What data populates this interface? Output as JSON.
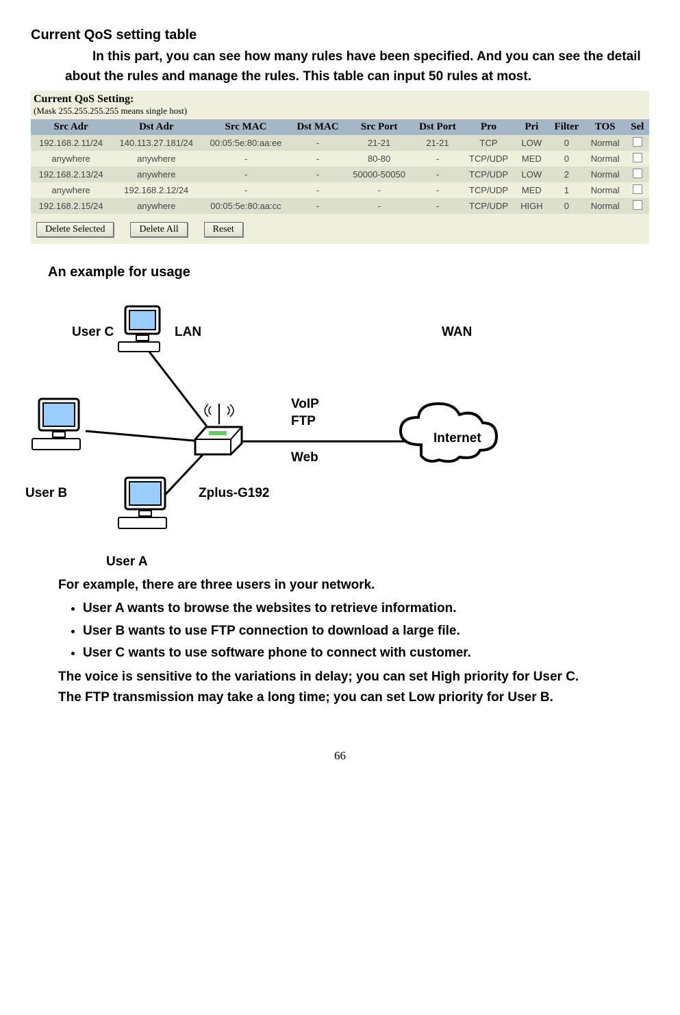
{
  "heading_qos": "Current QoS setting table",
  "intro_para": "In this part, you can see how many rules have been specified. And you can see the detail about the rules and manage the rules. This table can input 50 rules at most.",
  "shot": {
    "title": "Current QoS Setting:",
    "subtitle": "(Mask 255.255.255.255 means single host)",
    "headers": [
      "Src Adr",
      "Dst Adr",
      "Src MAC",
      "Dst MAC",
      "Src Port",
      "Dst Port",
      "Pro",
      "Pri",
      "Filter",
      "TOS",
      "Sel"
    ],
    "rows": [
      [
        "192.168.2.11/24",
        "140.113.27.181/24",
        "00:05:5e:80:aa:ee",
        "-",
        "21-21",
        "21-21",
        "TCP",
        "LOW",
        "0",
        "Normal"
      ],
      [
        "anywhere",
        "anywhere",
        "-",
        "-",
        "80-80",
        "-",
        "TCP/UDP",
        "MED",
        "0",
        "Normal"
      ],
      [
        "192.168.2.13/24",
        "anywhere",
        "-",
        "-",
        "50000-50050",
        "-",
        "TCP/UDP",
        "LOW",
        "2",
        "Normal"
      ],
      [
        "anywhere",
        "192.168.2.12/24",
        "-",
        "-",
        "-",
        "-",
        "TCP/UDP",
        "MED",
        "1",
        "Normal"
      ],
      [
        "192.168.2.15/24",
        "anywhere",
        "00:05:5e:80:aa:cc",
        "-",
        "-",
        "-",
        "TCP/UDP",
        "HIGH",
        "0",
        "Normal"
      ]
    ],
    "buttons": {
      "delete_selected": "Delete Selected",
      "delete_all": "Delete All",
      "reset": "Reset"
    }
  },
  "example_heading": "An example for usage",
  "diagram": {
    "user_c": "User C",
    "lan": "LAN",
    "wan": "WAN",
    "voip": "VoIP",
    "ftp": "FTP",
    "web": "Web",
    "internet": "Internet",
    "user_b": "User B",
    "router": "Zplus-G192",
    "user_a": "User A"
  },
  "body2": {
    "lead": "For example, there are three users in your network.",
    "b1": "User A wants to browse the websites to retrieve information.",
    "b2": "User B wants to use FTP connection to download a large file.",
    "b3": "User C wants to use software phone to connect with customer.",
    "p1": "The voice is sensitive to the variations in delay; you can set High priority for User C.",
    "p2": "The FTP transmission may take a long time; you can set Low priority for User B."
  },
  "pagenum": "66"
}
